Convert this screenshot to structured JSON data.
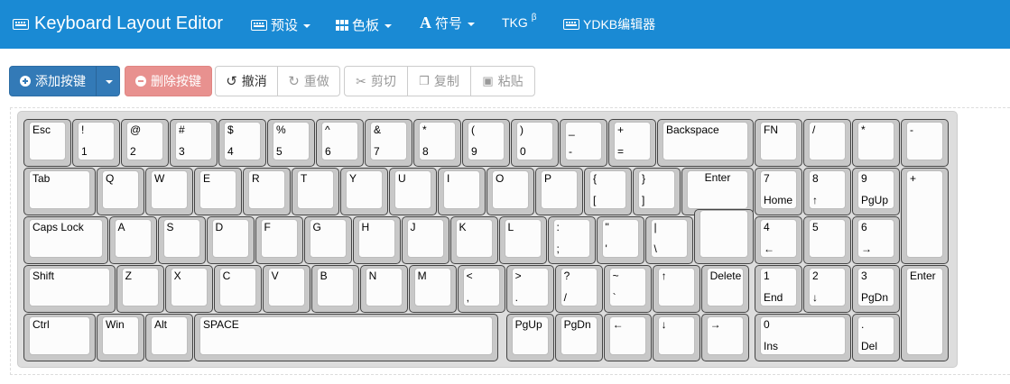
{
  "navbar": {
    "brand": "Keyboard Layout Editor",
    "preset": "预设",
    "palette": "色板",
    "symbols": "符号",
    "tkg": "TKG",
    "tkg_sup": "β",
    "ydkb": "YDKB编辑器"
  },
  "toolbar": {
    "add_key": "添加按键",
    "delete_key": "删除按键",
    "undo": "撤消",
    "redo": "重做",
    "cut": "剪切",
    "copy": "复制",
    "paste": "粘贴"
  },
  "colors": {
    "navbar": "#1a8ad4",
    "primary": "#337ab7",
    "danger": "#e8918f"
  },
  "keys": [
    {
      "top": "Esc",
      "bottom": ""
    },
    {
      "top": "!",
      "bottom": "1"
    },
    {
      "top": "@",
      "bottom": "2"
    },
    {
      "top": "#",
      "bottom": "3"
    },
    {
      "top": "$",
      "bottom": "4"
    },
    {
      "top": "%",
      "bottom": "5"
    },
    {
      "top": "^",
      "bottom": "6"
    },
    {
      "top": "&",
      "bottom": "7"
    },
    {
      "top": "*",
      "bottom": "8"
    },
    {
      "top": "(",
      "bottom": "9"
    },
    {
      "top": ")",
      "bottom": "0"
    },
    {
      "top": "_",
      "bottom": "-"
    },
    {
      "top": "+",
      "bottom": "="
    },
    {
      "top": "Backspace",
      "bottom": ""
    },
    {
      "top": "FN",
      "bottom": ""
    },
    {
      "top": "/",
      "bottom": ""
    },
    {
      "top": "*",
      "bottom": ""
    },
    {
      "top": "-",
      "bottom": ""
    },
    {
      "top": "Tab",
      "bottom": ""
    },
    {
      "top": "Q",
      "bottom": ""
    },
    {
      "top": "W",
      "bottom": ""
    },
    {
      "top": "E",
      "bottom": ""
    },
    {
      "top": "R",
      "bottom": ""
    },
    {
      "top": "T",
      "bottom": ""
    },
    {
      "top": "Y",
      "bottom": ""
    },
    {
      "top": "U",
      "bottom": ""
    },
    {
      "top": "I",
      "bottom": ""
    },
    {
      "top": "O",
      "bottom": ""
    },
    {
      "top": "P",
      "bottom": ""
    },
    {
      "top": "{",
      "bottom": "["
    },
    {
      "top": "}",
      "bottom": "]"
    },
    {
      "top": "Enter",
      "bottom": ""
    },
    {
      "top": "7",
      "bottom": "Home"
    },
    {
      "top": "8",
      "bottom": "↑"
    },
    {
      "top": "9",
      "bottom": "PgUp"
    },
    {
      "top": "+",
      "bottom": ""
    },
    {
      "top": "Caps Lock",
      "bottom": ""
    },
    {
      "top": "A",
      "bottom": ""
    },
    {
      "top": "S",
      "bottom": ""
    },
    {
      "top": "D",
      "bottom": ""
    },
    {
      "top": "F",
      "bottom": ""
    },
    {
      "top": "G",
      "bottom": ""
    },
    {
      "top": "H",
      "bottom": ""
    },
    {
      "top": "J",
      "bottom": ""
    },
    {
      "top": "K",
      "bottom": ""
    },
    {
      "top": "L",
      "bottom": ""
    },
    {
      "top": ":",
      "bottom": ";"
    },
    {
      "top": "\"",
      "bottom": "'"
    },
    {
      "top": "|",
      "bottom": "\\"
    },
    {
      "top": "4",
      "bottom": "←"
    },
    {
      "top": "5",
      "bottom": ""
    },
    {
      "top": "6",
      "bottom": "→"
    },
    {
      "top": "Shift",
      "bottom": ""
    },
    {
      "top": "Z",
      "bottom": ""
    },
    {
      "top": "X",
      "bottom": ""
    },
    {
      "top": "C",
      "bottom": ""
    },
    {
      "top": "V",
      "bottom": ""
    },
    {
      "top": "B",
      "bottom": ""
    },
    {
      "top": "N",
      "bottom": ""
    },
    {
      "top": "M",
      "bottom": ""
    },
    {
      "top": "<",
      "bottom": ","
    },
    {
      "top": ">",
      "bottom": "."
    },
    {
      "top": "?",
      "bottom": "/"
    },
    {
      "top": "~",
      "bottom": "`"
    },
    {
      "top": "↑",
      "bottom": ""
    },
    {
      "top": "Delete",
      "bottom": ""
    },
    {
      "top": "1",
      "bottom": "End"
    },
    {
      "top": "2",
      "bottom": "↓"
    },
    {
      "top": "3",
      "bottom": "PgDn"
    },
    {
      "top": "Enter",
      "bottom": ""
    },
    {
      "top": "Ctrl",
      "bottom": ""
    },
    {
      "top": "Win",
      "bottom": ""
    },
    {
      "top": "Alt",
      "bottom": ""
    },
    {
      "top": "SPACE",
      "bottom": ""
    },
    {
      "top": "PgUp",
      "bottom": ""
    },
    {
      "top": "PgDn",
      "bottom": ""
    },
    {
      "top": "←",
      "bottom": ""
    },
    {
      "top": "↓",
      "bottom": ""
    },
    {
      "top": "→",
      "bottom": ""
    },
    {
      "top": "0",
      "bottom": "Ins"
    },
    {
      "top": ".",
      "bottom": "Del"
    }
  ]
}
